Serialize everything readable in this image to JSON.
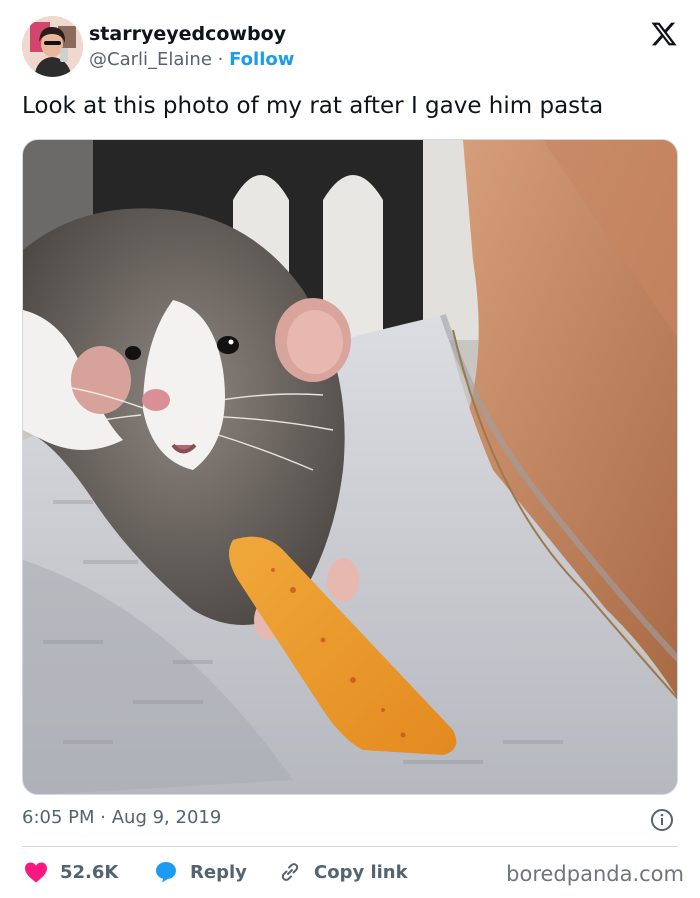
{
  "author": {
    "display_name": "starryeyedcowboy",
    "handle": "@Carli_Elaine",
    "separator": "·",
    "follow_label": "Follow"
  },
  "tweet": {
    "text": "Look at this photo of my rat after I gave him pasta",
    "time": "6:05 PM",
    "date_separator": "·",
    "date": "Aug 9, 2019"
  },
  "actions": {
    "likes": "52.6K",
    "reply_label": "Reply",
    "copy_link_label": "Copy link"
  },
  "watermark": "boredpanda.com",
  "icons": [
    "x-logo-icon",
    "info-icon",
    "heart-icon",
    "reply-bubble-icon",
    "link-icon"
  ],
  "colors": {
    "follow": "#1d9bf0",
    "heart": "#f91880",
    "reply": "#1d9bf0",
    "secondary_text": "#536471",
    "text": "#0f1419"
  }
}
